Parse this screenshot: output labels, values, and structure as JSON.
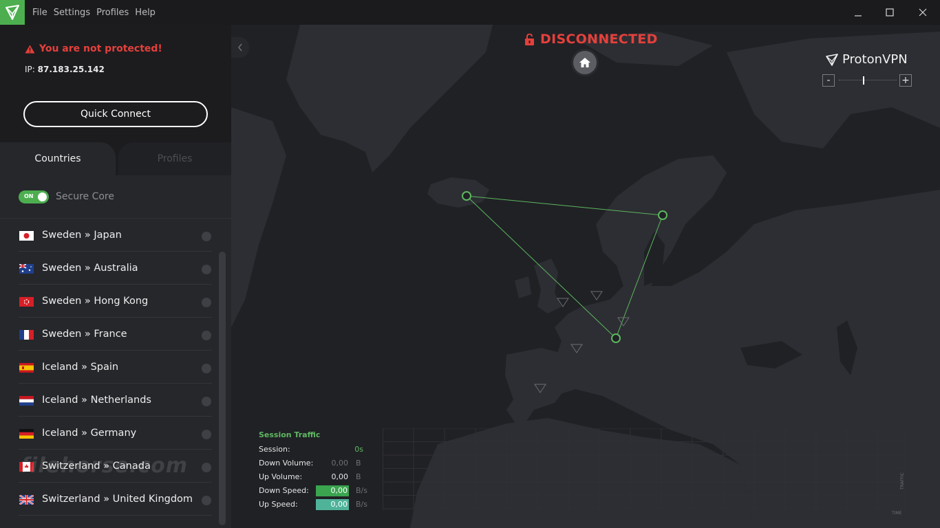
{
  "menu": [
    "File",
    "Settings",
    "Profiles",
    "Help"
  ],
  "status": {
    "warning": "You are not protected!",
    "ip_label": "IP:",
    "ip_value": "87.183.25.142"
  },
  "quick_connect": "Quick Connect",
  "tabs": [
    "Countries",
    "Profiles"
  ],
  "secure_core": {
    "toggle": "ON",
    "label": "Secure Core"
  },
  "servers": [
    {
      "label": "Sweden » Japan",
      "flag": "jp"
    },
    {
      "label": "Sweden » Australia",
      "flag": "au"
    },
    {
      "label": "Sweden » Hong Kong",
      "flag": "hk"
    },
    {
      "label": "Sweden » France",
      "flag": "fr"
    },
    {
      "label": "Iceland » Spain",
      "flag": "es"
    },
    {
      "label": "Iceland » Netherlands",
      "flag": "nl"
    },
    {
      "label": "Iceland » Germany",
      "flag": "de"
    },
    {
      "label": "Switzerland » Canada",
      "flag": "ca"
    },
    {
      "label": "Switzerland » United Kingdom",
      "flag": "gb"
    }
  ],
  "watermark": "filehorse.com",
  "map": {
    "connection": "DISCONNECTED",
    "brand": "ProtonVPN",
    "zoom_minus": "-",
    "zoom_plus": "+"
  },
  "traffic": {
    "title": "Session Traffic",
    "rows": [
      {
        "label": "Session:",
        "value": "0s",
        "unit": ""
      },
      {
        "label": "Down Volume:",
        "value": "0,00",
        "unit": "B"
      },
      {
        "label": "Up Volume:",
        "value": "0,00",
        "unit": "B"
      },
      {
        "label": "Down Speed:",
        "value": "0,00",
        "unit": "B/s"
      },
      {
        "label": "Up Speed:",
        "value": "0,00",
        "unit": "B/s"
      }
    ],
    "axis_y": "TRAFFIC",
    "axis_x": "TIME"
  },
  "colors": {
    "accent": "#4cae4f",
    "danger": "#e5403b",
    "down_speed": "#3aa44f",
    "up_speed": "#4fb39a"
  }
}
